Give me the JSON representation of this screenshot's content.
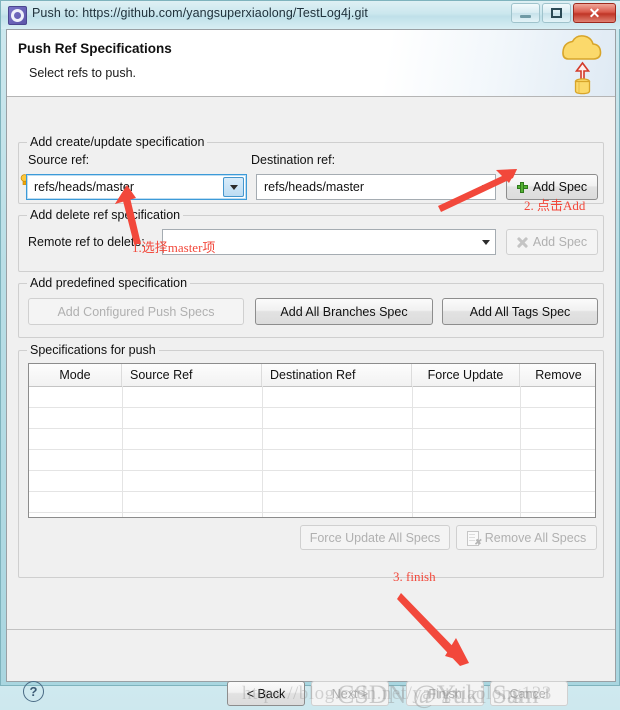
{
  "window": {
    "title": "Push to: https://github.com/yangsuperxiaolong/TestLog4j.git",
    "icon": "gear-icon",
    "minimize_label": "Minimize",
    "maximize_label": "Maximize",
    "close_label": "✕"
  },
  "banner": {
    "title": "Push Ref Specifications",
    "subtitle": "Select refs to push.",
    "art": "cloud-push-icon"
  },
  "create_update_group": {
    "legend": "Add create/update specification",
    "source_label": "Source ref:",
    "source_value": "refs/heads/master",
    "destination_label": "Destination ref:",
    "destination_value": "refs/heads/master",
    "add_spec_label": "Add Spec"
  },
  "delete_group": {
    "legend": "Add delete ref specification",
    "remote_label": "Remote ref to delete:",
    "remote_value": "",
    "add_spec_label": "Add Spec"
  },
  "predefined_group": {
    "legend": "Add predefined specification",
    "add_configured_label": "Add Configured Push Specs",
    "add_all_branches_label": "Add All Branches Spec",
    "add_all_tags_label": "Add All Tags Spec"
  },
  "specs_group": {
    "legend": "Specifications for push",
    "columns": [
      "Mode",
      "Source Ref",
      "Destination Ref",
      "Force Update",
      "Remove"
    ],
    "rows": [],
    "force_update_all_label": "Force Update All Specs",
    "remove_all_label": "Remove All Specs"
  },
  "footer": {
    "help_label": "?",
    "back_label": "< Back",
    "next_label": "Next >",
    "finish_label": "Finish",
    "cancel_label": "Cancel"
  },
  "annotations": [
    {
      "id": "a1",
      "text": "1.选择master项"
    },
    {
      "id": "a2",
      "text": "2. 点击Add"
    },
    {
      "id": "a3",
      "text": "3. finish"
    }
  ],
  "watermark": {
    "url": "https://blog.csdn.net/yangxiaolong123",
    "brand": "CSDN @Yuki Sam"
  },
  "colors": {
    "annotation": "#f2483b",
    "accent_green": "#55b234",
    "frame": "#a9d6e0"
  }
}
